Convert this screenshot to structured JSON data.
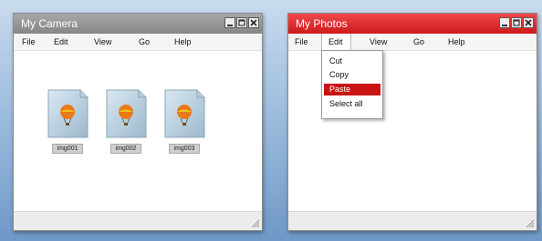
{
  "camera_window": {
    "title": "My Camera",
    "menu": [
      "File",
      "Edit",
      "View",
      "Go",
      "Help"
    ],
    "files": [
      {
        "name": "img001",
        "icon": "balloon-image-icon"
      },
      {
        "name": "img002",
        "icon": "balloon-image-icon"
      },
      {
        "name": "img003",
        "icon": "balloon-image-icon"
      }
    ]
  },
  "photos_window": {
    "title": "My Photos",
    "menu": [
      "File",
      "Edit",
      "View",
      "Go",
      "Help"
    ],
    "open_menu": "Edit",
    "edit_menu_items": [
      "Cut",
      "Copy",
      "Paste",
      "Select all"
    ],
    "highlighted_item": "Paste"
  },
  "colors": {
    "inactive_titlebar": "#8f8f8f",
    "active_titlebar": "#d92626",
    "selection": "#c81414",
    "desktop": "#8fb3db"
  }
}
